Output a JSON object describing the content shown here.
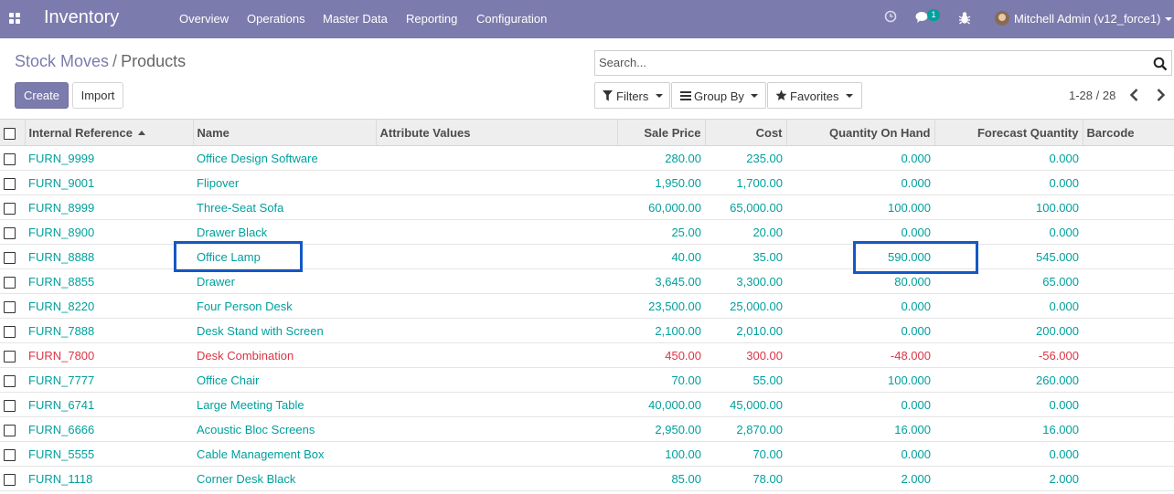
{
  "navbar": {
    "app_title": "Inventory",
    "menus": [
      "Overview",
      "Operations",
      "Master Data",
      "Reporting",
      "Configuration"
    ],
    "message_count": "1",
    "user_label": "Mitchell Admin (v12_force1)"
  },
  "breadcrumb": {
    "parent": "Stock Moves",
    "separator": "/",
    "current": "Products"
  },
  "buttons": {
    "create": "Create",
    "import": "Import"
  },
  "search": {
    "placeholder": "Search...",
    "value": ""
  },
  "filters": {
    "filters_label": "Filters",
    "group_by_label": "Group By",
    "favorites_label": "Favorites"
  },
  "pager": {
    "value": "1-28 / 28"
  },
  "table": {
    "columns": [
      "Internal Reference",
      "Name",
      "Attribute Values",
      "Sale Price",
      "Cost",
      "Quantity On Hand",
      "Forecast Quantity",
      "Barcode"
    ],
    "rows": [
      {
        "ref": "FURN_9999",
        "name": "Office Design Software",
        "attr": "",
        "price": "280.00",
        "cost": "235.00",
        "onhand": "0.000",
        "forecast": "0.000",
        "barcode": "",
        "warn": false
      },
      {
        "ref": "FURN_9001",
        "name": "Flipover",
        "attr": "",
        "price": "1,950.00",
        "cost": "1,700.00",
        "onhand": "0.000",
        "forecast": "0.000",
        "barcode": "",
        "warn": false
      },
      {
        "ref": "FURN_8999",
        "name": "Three-Seat Sofa",
        "attr": "",
        "price": "60,000.00",
        "cost": "65,000.00",
        "onhand": "100.000",
        "forecast": "100.000",
        "barcode": "",
        "warn": false
      },
      {
        "ref": "FURN_8900",
        "name": "Drawer Black",
        "attr": "",
        "price": "25.00",
        "cost": "20.00",
        "onhand": "0.000",
        "forecast": "0.000",
        "barcode": "",
        "warn": false
      },
      {
        "ref": "FURN_8888",
        "name": "Office Lamp",
        "attr": "",
        "price": "40.00",
        "cost": "35.00",
        "onhand": "590.000",
        "forecast": "545.000",
        "barcode": "",
        "warn": false
      },
      {
        "ref": "FURN_8855",
        "name": "Drawer",
        "attr": "",
        "price": "3,645.00",
        "cost": "3,300.00",
        "onhand": "80.000",
        "forecast": "65.000",
        "barcode": "",
        "warn": false
      },
      {
        "ref": "FURN_8220",
        "name": "Four Person Desk",
        "attr": "",
        "price": "23,500.00",
        "cost": "25,000.00",
        "onhand": "0.000",
        "forecast": "0.000",
        "barcode": "",
        "warn": false
      },
      {
        "ref": "FURN_7888",
        "name": "Desk Stand with Screen",
        "attr": "",
        "price": "2,100.00",
        "cost": "2,010.00",
        "onhand": "0.000",
        "forecast": "200.000",
        "barcode": "",
        "warn": false
      },
      {
        "ref": "FURN_7800",
        "name": "Desk Combination",
        "attr": "",
        "price": "450.00",
        "cost": "300.00",
        "onhand": "-48.000",
        "forecast": "-56.000",
        "barcode": "",
        "warn": true
      },
      {
        "ref": "FURN_7777",
        "name": "Office Chair",
        "attr": "",
        "price": "70.00",
        "cost": "55.00",
        "onhand": "100.000",
        "forecast": "260.000",
        "barcode": "",
        "warn": false
      },
      {
        "ref": "FURN_6741",
        "name": "Large Meeting Table",
        "attr": "",
        "price": "40,000.00",
        "cost": "45,000.00",
        "onhand": "0.000",
        "forecast": "0.000",
        "barcode": "",
        "warn": false
      },
      {
        "ref": "FURN_6666",
        "name": "Acoustic Bloc Screens",
        "attr": "",
        "price": "2,950.00",
        "cost": "2,870.00",
        "onhand": "16.000",
        "forecast": "16.000",
        "barcode": "",
        "warn": false
      },
      {
        "ref": "FURN_5555",
        "name": "Cable Management Box",
        "attr": "",
        "price": "100.00",
        "cost": "70.00",
        "onhand": "0.000",
        "forecast": "0.000",
        "barcode": "",
        "warn": false
      },
      {
        "ref": "FURN_1118",
        "name": "Corner Desk Black",
        "attr": "",
        "price": "85.00",
        "cost": "78.00",
        "onhand": "2.000",
        "forecast": "2.000",
        "barcode": "",
        "warn": false
      }
    ]
  },
  "colors": {
    "navbar": "#7c7bad",
    "link": "#00a09d",
    "warning": "#dc3545",
    "highlight": "#1458c8"
  },
  "icons": {
    "apps": "apps-grid-icon",
    "clock": "clock-icon",
    "chat": "chat-icon",
    "debug": "bug-icon",
    "search": "search-icon"
  }
}
